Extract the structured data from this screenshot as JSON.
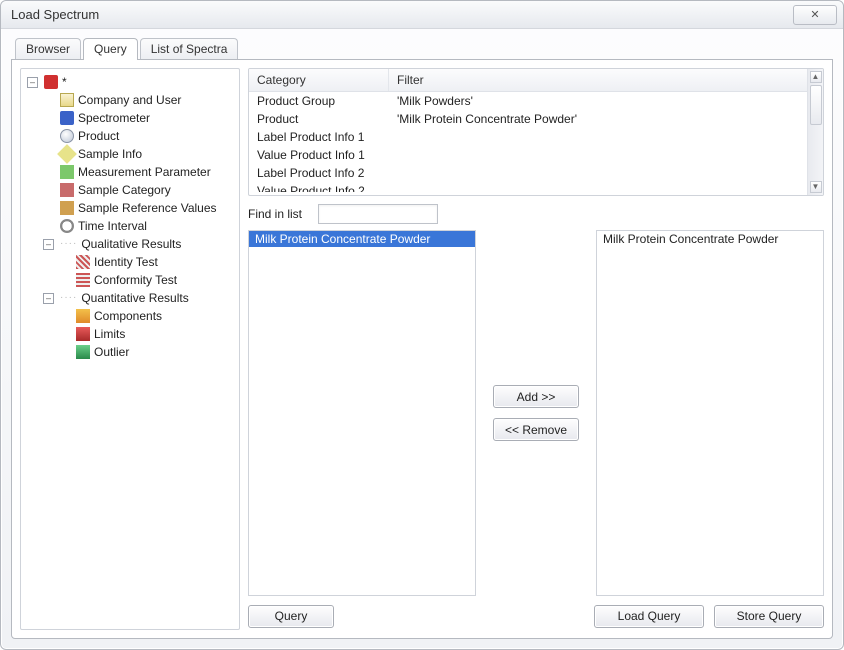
{
  "window": {
    "title": "Load Spectrum",
    "close_glyph": "✕"
  },
  "tabs": {
    "browser": "Browser",
    "query": "Query",
    "list": "List of Spectra",
    "active": "query"
  },
  "tree": {
    "root": "*",
    "items": [
      {
        "label": "Company and User",
        "icon": "ic-company"
      },
      {
        "label": "Spectrometer",
        "icon": "ic-spec"
      },
      {
        "label": "Product",
        "icon": "ic-product"
      },
      {
        "label": "Sample Info",
        "icon": "ic-sample"
      },
      {
        "label": "Measurement Parameter",
        "icon": "ic-meas"
      },
      {
        "label": "Sample Category",
        "icon": "ic-cat"
      },
      {
        "label": "Sample Reference Values",
        "icon": "ic-ref"
      },
      {
        "label": "Time Interval",
        "icon": "ic-time"
      }
    ],
    "qualitative": {
      "label": "Qualitative Results",
      "children": [
        {
          "label": "Identity Test",
          "icon": "ic-id"
        },
        {
          "label": "Conformity Test",
          "icon": "ic-conf"
        }
      ]
    },
    "quantitative": {
      "label": "Quantitative Results",
      "children": [
        {
          "label": "Components",
          "icon": "ic-comp"
        },
        {
          "label": "Limits",
          "icon": "ic-lim"
        },
        {
          "label": "Outlier",
          "icon": "ic-out"
        }
      ]
    }
  },
  "filter": {
    "head_category": "Category",
    "head_filter": "Filter",
    "rows": [
      {
        "category": "Product Group",
        "value": "'Milk Powders'"
      },
      {
        "category": "Product",
        "value": "'Milk Protein Concentrate Powder'"
      },
      {
        "category": "Label Product Info 1",
        "value": ""
      },
      {
        "category": "Value Product Info 1",
        "value": ""
      },
      {
        "category": "Label Product Info 2",
        "value": ""
      },
      {
        "category": "Value Product Info 2",
        "value": ""
      }
    ]
  },
  "find": {
    "label": "Find in list",
    "value": ""
  },
  "leftList": {
    "items": [
      {
        "label": "Milk Protein Concentrate Powder",
        "selected": true
      }
    ]
  },
  "rightList": {
    "items": [
      {
        "label": "Milk Protein Concentrate Powder",
        "selected": false
      }
    ]
  },
  "buttons": {
    "add": "Add >>",
    "remove": "<< Remove",
    "query": "Query",
    "load": "Load Query",
    "store": "Store Query"
  }
}
